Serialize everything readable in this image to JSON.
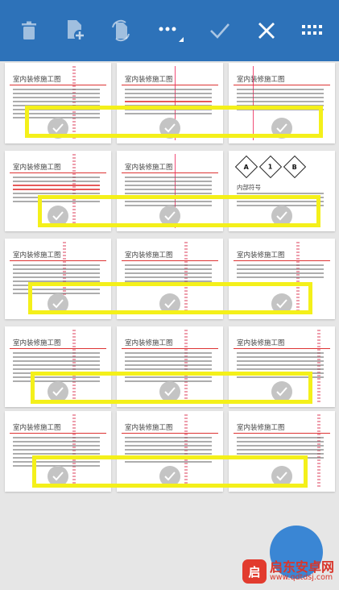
{
  "toolbar": {
    "background": "#2d72b9",
    "icons": [
      "trash-icon",
      "add-page-icon",
      "rotate-page-icon",
      "more-icon",
      "confirm-check-icon",
      "close-icon",
      "grid-view-icon"
    ]
  },
  "pages": [
    {
      "header": "室内装修施工图",
      "selected": true
    },
    {
      "header": "室内装修施工图",
      "selected": true
    },
    {
      "header": "室内装修施工图",
      "selected": true
    },
    {
      "header": "室内装修施工图",
      "selected": true
    },
    {
      "header": "室内装修施工图",
      "selected": true
    },
    {
      "header": "内部符号",
      "selected": true,
      "symbols": [
        "A",
        "1",
        "B"
      ]
    },
    {
      "header": "室内装修施工图",
      "selected": true
    },
    {
      "header": "室内装修施工图",
      "selected": true
    },
    {
      "header": "室内装修施工图",
      "selected": true
    },
    {
      "header": "室内装修施工图",
      "selected": true
    },
    {
      "header": "室内装修施工图",
      "selected": true
    },
    {
      "header": "室内装修施工图",
      "selected": true
    },
    {
      "header": "室内装修施工图",
      "selected": true
    },
    {
      "header": "室内装修施工图",
      "selected": true
    },
    {
      "header": "室内装修施工图",
      "selected": true
    }
  ],
  "highlight_color": "#f4f01a",
  "fab": {
    "color": "#3a86d4"
  },
  "watermark": {
    "badge": "启",
    "title": "启东安卓网",
    "url": "www.qdtdsj.com"
  }
}
